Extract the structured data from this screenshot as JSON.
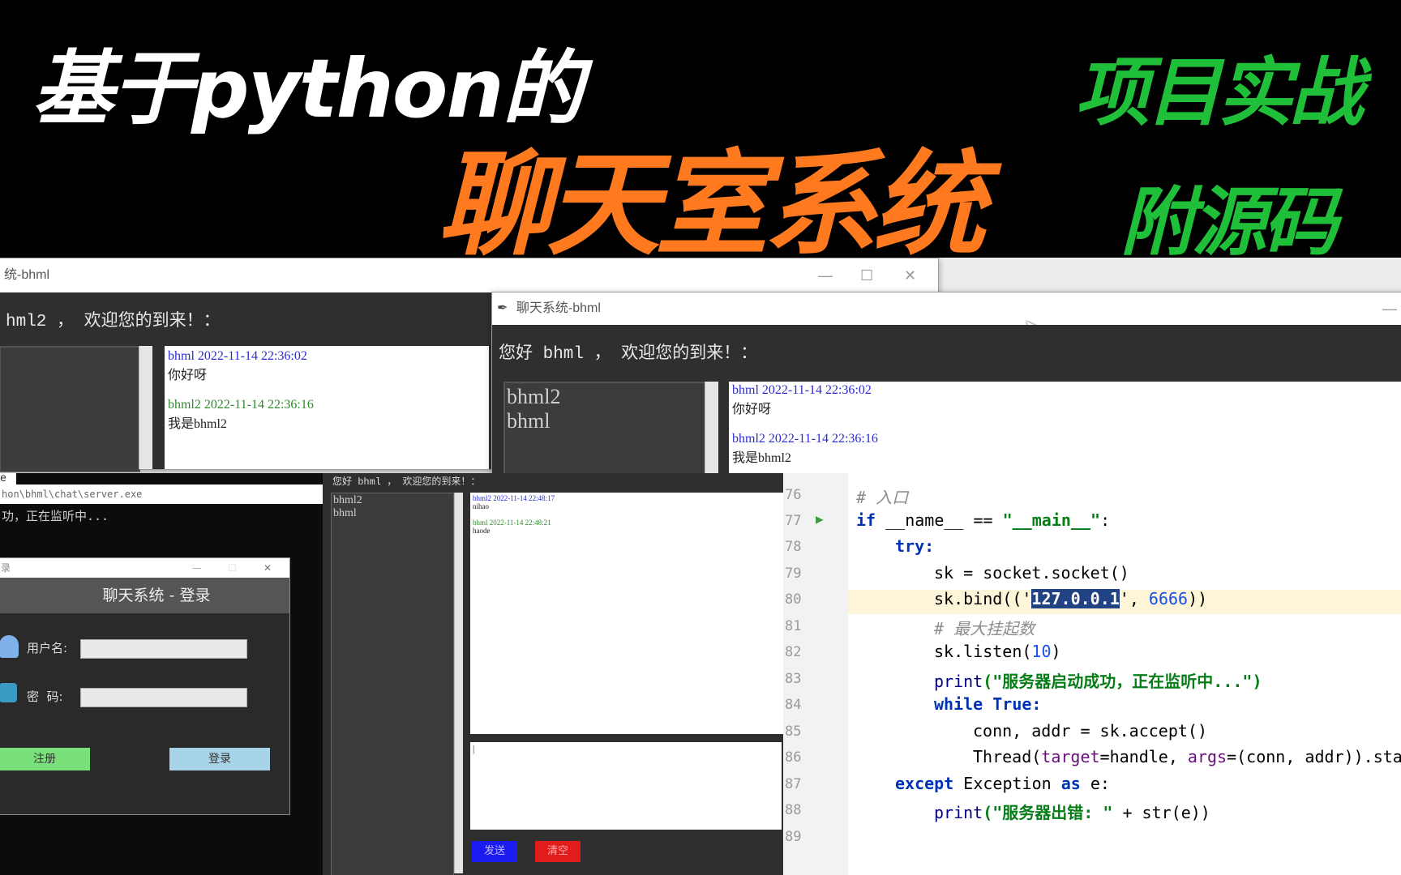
{
  "banner": {
    "line1": "基于python的",
    "line2": "聊天室系统",
    "tag1": "项目实战",
    "tag2": "附源码"
  },
  "back_window": {
    "title": "统-bhml",
    "welcome": "hml2 ， 欢迎您的到来！：",
    "messages": [
      {
        "head": "bhml 2022-11-14 22:36:02",
        "text": "你好呀"
      },
      {
        "head": "bhml2 2022-11-14 22:36:16",
        "text": "我是bhml2"
      }
    ]
  },
  "front_window": {
    "title": "聊天系统-bhml",
    "welcome": "您好 bhml ， 欢迎您的到来！：",
    "users": [
      "bhml2",
      "bhml"
    ],
    "messages": [
      {
        "head": "bhml 2022-11-14 22:36:02",
        "text": "你好呀"
      },
      {
        "head": "bhml2 2022-11-14 22:36:16",
        "text": "我是bhml2"
      }
    ]
  },
  "console_window": {
    "path": "hon\\bhml\\chat\\server.exe",
    "status": "功，正在监听中...",
    "fragment": "e"
  },
  "login_dialog": {
    "title": "录",
    "heading": "聊天系统 - 登录",
    "username_label": "用户名:",
    "password_label": "密  码:",
    "register_button": "注册",
    "login_button": "登录"
  },
  "small_chat": {
    "welcome": "您好 bhml ， 欢迎您的到来！：",
    "users": [
      "bhml2",
      "bhml"
    ],
    "messages": [
      {
        "head": "bhml2 2022-11-14 22:48:17",
        "text": "nihao"
      },
      {
        "head": "bhml 2022-11-14 22:48:21",
        "text": "haode"
      }
    ],
    "input_value": "|",
    "send_button": "发送",
    "clear_button": "清空"
  },
  "editor": {
    "line_numbers": [
      "76",
      "77",
      "78",
      "79",
      "80",
      "81",
      "82",
      "83",
      "84",
      "85",
      "86",
      "87",
      "88",
      "89"
    ],
    "comment_entry": "# 入口",
    "comment_backlog": "# 最大挂起数",
    "if_kw": "if",
    "if_rest": " __name__ == ",
    "main_str": "\"__main__\"",
    "colon": ":",
    "try_kw": "try:",
    "sk_socket": "sk = socket.socket()",
    "bind_pre": "sk.bind(('",
    "bind_ip": "127.0.0.1",
    "bind_post": "', ",
    "bind_port": "6666",
    "bind_end": "))",
    "listen_pre": "sk.listen(",
    "listen_num": "10",
    "listen_end": ")",
    "print_kw": "print",
    "print1_str": "(\"服务器启动成功，正在监听中...\")",
    "while_kw": "while True:",
    "accept_line": "conn, addr = sk.accept()",
    "thread_pre": "Thread(",
    "thread_target": "target",
    "thread_mid": "=handle, ",
    "thread_args": "args",
    "thread_end": "=(conn, addr)).sta",
    "except_kw": "except",
    "except_rest": " Exception ",
    "as_kw": "as",
    "except_e": " e:",
    "print2_str": "(\"服务器出错: \"",
    "print2_rest": " + str(e))"
  }
}
